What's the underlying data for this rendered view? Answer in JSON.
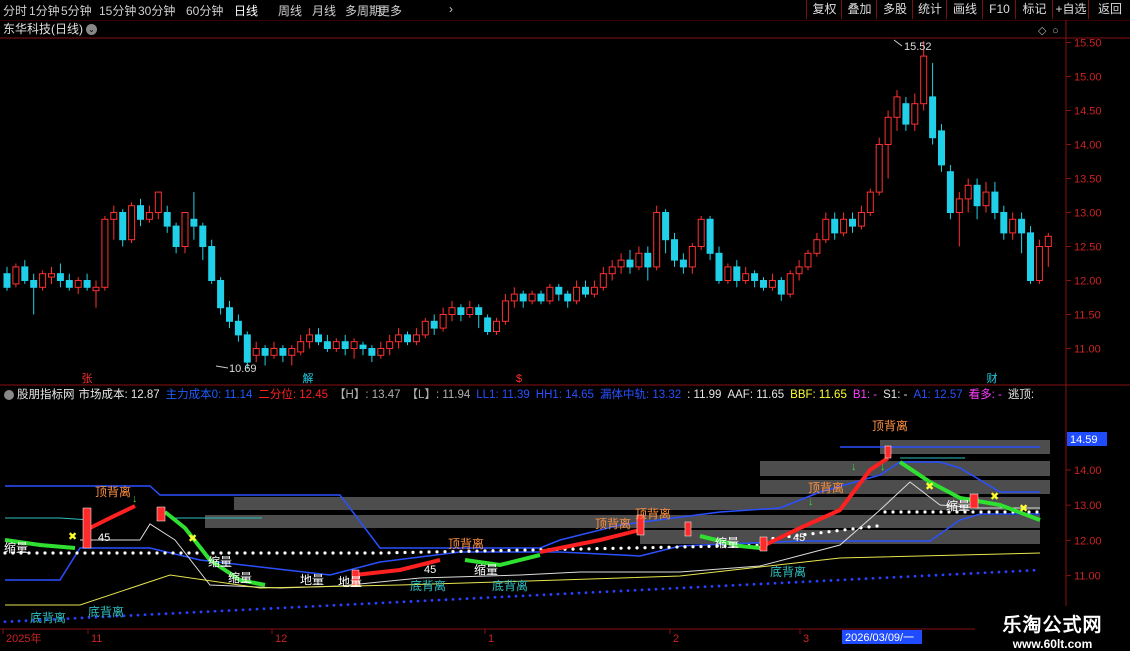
{
  "toolbar": {
    "periods": [
      "分时",
      "1分钟",
      "5分钟",
      "15分钟",
      "30分钟",
      "60分钟",
      "日线",
      "周线",
      "月线",
      "多周期",
      "更多"
    ],
    "active": "日线",
    "right_buttons": [
      "复权",
      "叠加",
      "多股",
      "统计",
      "画线",
      "F10",
      "标记",
      "+自选",
      "返回"
    ]
  },
  "chart_header": {
    "title": "东华科技(日线)"
  },
  "price_axis": {
    "ticks": [
      "15.50",
      "15.00",
      "14.50",
      "14.00",
      "13.50",
      "13.00",
      "12.50",
      "12.00",
      "11.50",
      "11.00"
    ]
  },
  "price_annotations": {
    "high": "15.52",
    "low": "10.69"
  },
  "event_markers": [
    "张",
    "解",
    "$",
    "财"
  ],
  "indicator": {
    "name": "股朋指标网",
    "items": [
      {
        "label": "市场成本:",
        "value": "12.87",
        "color": "#e6e6e6"
      },
      {
        "label": "主力成本0:",
        "value": "11.14",
        "color": "#1f5cff"
      },
      {
        "label": "二分位:",
        "value": "12.45",
        "color": "#ff2020"
      },
      {
        "label": "【H】:",
        "value": "13.47",
        "color": "#b0b0b0"
      },
      {
        "label": "【L】:",
        "value": "11.94",
        "color": "#b0b0b0"
      },
      {
        "label": "LL1:",
        "value": "11.39",
        "color": "#2a50ff"
      },
      {
        "label": "HH1:",
        "value": "14.65",
        "color": "#2a50ff"
      },
      {
        "label": "漏体中轨:",
        "value": "13.32",
        "color": "#2a50ff"
      },
      {
        "label": ":",
        "value": "11.99",
        "color": "#e6e6e6"
      },
      {
        "label": "AAF:",
        "value": "11.65",
        "color": "#e6e6e6"
      },
      {
        "label": "BBF:",
        "value": "11.65",
        "color": "#ffff30"
      },
      {
        "label": "B1:",
        "value": "-",
        "color": "#ff40ff"
      },
      {
        "label": "S1:",
        "value": "-",
        "color": "#e6e6e6"
      },
      {
        "label": "A1:",
        "value": "12.57",
        "color": "#2a50ff"
      },
      {
        "label": "看多:",
        "value": "-",
        "color": "#ff40ff"
      },
      {
        "label": "逃顶:",
        "value": "",
        "color": "#e6e6e6"
      }
    ],
    "axis_ticks": [
      "14.00",
      "13.00",
      "12.00",
      "11.00"
    ],
    "current_price_tag": "14.59",
    "labels": {
      "top_divergence": "顶背离",
      "bottom_divergence": "底背离",
      "shrink": "缩量",
      "earth": "地量",
      "num45": "45"
    }
  },
  "time_axis": {
    "labels": [
      "2025年",
      "11",
      "12",
      "1",
      "2",
      "3"
    ],
    "cursor_date": "2026/03/09/一"
  },
  "watermark": {
    "name": "乐淘公式网",
    "url": "www.60lt.com"
  },
  "colors": {
    "up": "#ff3030",
    "down": "#20d0e8",
    "grid_axis": "#8a1010"
  },
  "candles": [
    [
      12.1,
      11.9,
      12.2,
      11.85
    ],
    [
      11.95,
      12.2,
      12.25,
      11.9
    ],
    [
      12.2,
      12.0,
      12.3,
      11.95
    ],
    [
      12.0,
      11.9,
      12.1,
      11.5
    ],
    [
      11.9,
      12.1,
      12.15,
      11.85
    ],
    [
      12.05,
      12.1,
      12.2,
      11.95
    ],
    [
      12.1,
      12.0,
      12.25,
      11.9
    ],
    [
      12.0,
      11.9,
      12.1,
      11.85
    ],
    [
      11.9,
      12.0,
      12.05,
      11.8
    ],
    [
      12.0,
      11.9,
      12.1,
      11.85
    ],
    [
      11.85,
      11.9,
      12.0,
      11.6
    ],
    [
      11.9,
      12.9,
      12.95,
      11.85
    ],
    [
      12.9,
      13.0,
      13.1,
      12.6
    ],
    [
      13.0,
      12.6,
      13.05,
      12.5
    ],
    [
      12.6,
      13.1,
      13.15,
      12.55
    ],
    [
      13.1,
      12.9,
      13.2,
      12.8
    ],
    [
      12.9,
      13.0,
      13.1,
      12.85
    ],
    [
      13.0,
      13.3,
      13.3,
      12.9
    ],
    [
      13.0,
      12.8,
      13.1,
      12.7
    ],
    [
      12.8,
      12.5,
      12.85,
      12.4
    ],
    [
      12.5,
      13.0,
      13.0,
      12.4
    ],
    [
      12.9,
      12.8,
      13.3,
      12.6
    ],
    [
      12.8,
      12.5,
      12.85,
      12.3
    ],
    [
      12.5,
      12.0,
      12.6,
      11.95
    ],
    [
      12.0,
      11.6,
      12.05,
      11.5
    ],
    [
      11.6,
      11.4,
      11.7,
      11.3
    ],
    [
      11.4,
      11.2,
      11.5,
      11.1
    ],
    [
      11.2,
      10.8,
      11.25,
      10.7
    ],
    [
      10.9,
      11.0,
      11.1,
      10.8
    ],
    [
      11.0,
      10.9,
      11.05,
      10.75
    ],
    [
      10.9,
      11.0,
      11.1,
      10.85
    ],
    [
      11.0,
      10.9,
      11.05,
      10.8
    ],
    [
      10.9,
      11.0,
      11.05,
      10.75
    ],
    [
      10.95,
      11.1,
      11.2,
      10.9
    ],
    [
      11.1,
      11.2,
      11.3,
      11.0
    ],
    [
      11.2,
      11.1,
      11.3,
      11.05
    ],
    [
      11.1,
      11.0,
      11.2,
      10.95
    ],
    [
      11.0,
      11.1,
      11.15,
      10.95
    ],
    [
      11.1,
      11.0,
      11.2,
      10.9
    ],
    [
      11.0,
      11.1,
      11.15,
      10.85
    ],
    [
      11.05,
      11.0,
      11.1,
      10.9
    ],
    [
      11.0,
      10.9,
      11.05,
      10.8
    ],
    [
      10.9,
      11.0,
      11.1,
      10.85
    ],
    [
      11.0,
      11.1,
      11.2,
      10.9
    ],
    [
      11.1,
      11.2,
      11.3,
      11.0
    ],
    [
      11.2,
      11.1,
      11.25,
      11.05
    ],
    [
      11.1,
      11.2,
      11.3,
      11.05
    ],
    [
      11.2,
      11.4,
      11.45,
      11.15
    ],
    [
      11.4,
      11.3,
      11.5,
      11.2
    ],
    [
      11.3,
      11.5,
      11.6,
      11.25
    ],
    [
      11.5,
      11.6,
      11.7,
      11.4
    ],
    [
      11.6,
      11.5,
      11.65,
      11.4
    ],
    [
      11.5,
      11.6,
      11.7,
      11.45
    ],
    [
      11.6,
      11.5,
      11.65,
      11.3
    ],
    [
      11.45,
      11.25,
      11.5,
      11.2
    ],
    [
      11.25,
      11.4,
      11.45,
      11.2
    ],
    [
      11.4,
      11.7,
      11.8,
      11.35
    ],
    [
      11.7,
      11.8,
      11.9,
      11.6
    ],
    [
      11.8,
      11.7,
      11.85,
      11.6
    ],
    [
      11.7,
      11.8,
      11.85,
      11.65
    ],
    [
      11.8,
      11.7,
      11.85,
      11.65
    ],
    [
      11.7,
      11.9,
      11.95,
      11.65
    ],
    [
      11.9,
      11.8,
      11.95,
      11.7
    ],
    [
      11.8,
      11.7,
      11.85,
      11.6
    ],
    [
      11.7,
      11.9,
      12.0,
      11.65
    ],
    [
      11.9,
      11.8,
      12.0,
      11.75
    ],
    [
      11.8,
      11.9,
      12.0,
      11.75
    ],
    [
      11.9,
      12.1,
      12.2,
      11.85
    ],
    [
      12.1,
      12.2,
      12.3,
      12.0
    ],
    [
      12.2,
      12.3,
      12.4,
      12.1
    ],
    [
      12.3,
      12.2,
      12.45,
      12.1
    ],
    [
      12.2,
      12.4,
      12.5,
      12.15
    ],
    [
      12.4,
      12.2,
      12.5,
      12.0
    ],
    [
      12.2,
      13.0,
      13.1,
      12.15
    ],
    [
      13.0,
      12.6,
      13.05,
      12.4
    ],
    [
      12.6,
      12.3,
      12.7,
      12.2
    ],
    [
      12.3,
      12.2,
      12.4,
      12.1
    ],
    [
      12.2,
      12.5,
      12.55,
      12.1
    ],
    [
      12.5,
      12.9,
      12.95,
      12.45
    ],
    [
      12.9,
      12.4,
      12.95,
      12.3
    ],
    [
      12.4,
      12.0,
      12.5,
      11.95
    ],
    [
      12.0,
      12.2,
      12.25,
      11.95
    ],
    [
      12.2,
      12.0,
      12.3,
      11.9
    ],
    [
      12.0,
      12.1,
      12.2,
      11.95
    ],
    [
      12.1,
      12.0,
      12.15,
      11.9
    ],
    [
      12.0,
      11.9,
      12.05,
      11.85
    ],
    [
      11.9,
      12.0,
      12.1,
      11.85
    ],
    [
      12.0,
      11.8,
      12.05,
      11.7
    ],
    [
      11.8,
      12.1,
      12.15,
      11.75
    ],
    [
      12.1,
      12.2,
      12.3,
      12.0
    ],
    [
      12.2,
      12.4,
      12.45,
      12.15
    ],
    [
      12.4,
      12.6,
      12.7,
      12.35
    ],
    [
      12.6,
      12.9,
      13.0,
      12.55
    ],
    [
      12.9,
      12.7,
      13.0,
      12.6
    ],
    [
      12.7,
      12.9,
      13.0,
      12.65
    ],
    [
      12.9,
      12.8,
      13.0,
      12.7
    ],
    [
      12.8,
      13.0,
      13.1,
      12.75
    ],
    [
      13.0,
      13.3,
      13.35,
      12.95
    ],
    [
      13.3,
      14.0,
      14.1,
      13.25
    ],
    [
      14.0,
      14.4,
      14.5,
      13.5
    ],
    [
      14.4,
      14.7,
      14.8,
      14.2
    ],
    [
      14.6,
      14.3,
      14.7,
      14.2
    ],
    [
      14.3,
      14.6,
      14.75,
      14.2
    ],
    [
      14.6,
      15.3,
      15.52,
      14.5
    ],
    [
      14.7,
      14.1,
      15.2,
      14.0
    ],
    [
      14.2,
      13.7,
      14.3,
      13.6
    ],
    [
      13.6,
      13.0,
      13.7,
      12.9
    ],
    [
      13.0,
      13.2,
      13.3,
      12.5
    ],
    [
      13.2,
      13.4,
      13.5,
      13.0
    ],
    [
      13.4,
      13.1,
      13.5,
      12.9
    ],
    [
      13.1,
      13.3,
      13.45,
      13.0
    ],
    [
      13.3,
      13.0,
      13.45,
      12.9
    ],
    [
      13.0,
      12.7,
      13.1,
      12.6
    ],
    [
      12.7,
      12.9,
      13.0,
      12.6
    ],
    [
      12.9,
      12.7,
      13.0,
      12.4
    ],
    [
      12.7,
      12.0,
      12.8,
      11.95
    ],
    [
      12.0,
      12.5,
      12.6,
      11.95
    ],
    [
      12.5,
      12.65,
      12.7,
      12.2
    ]
  ]
}
